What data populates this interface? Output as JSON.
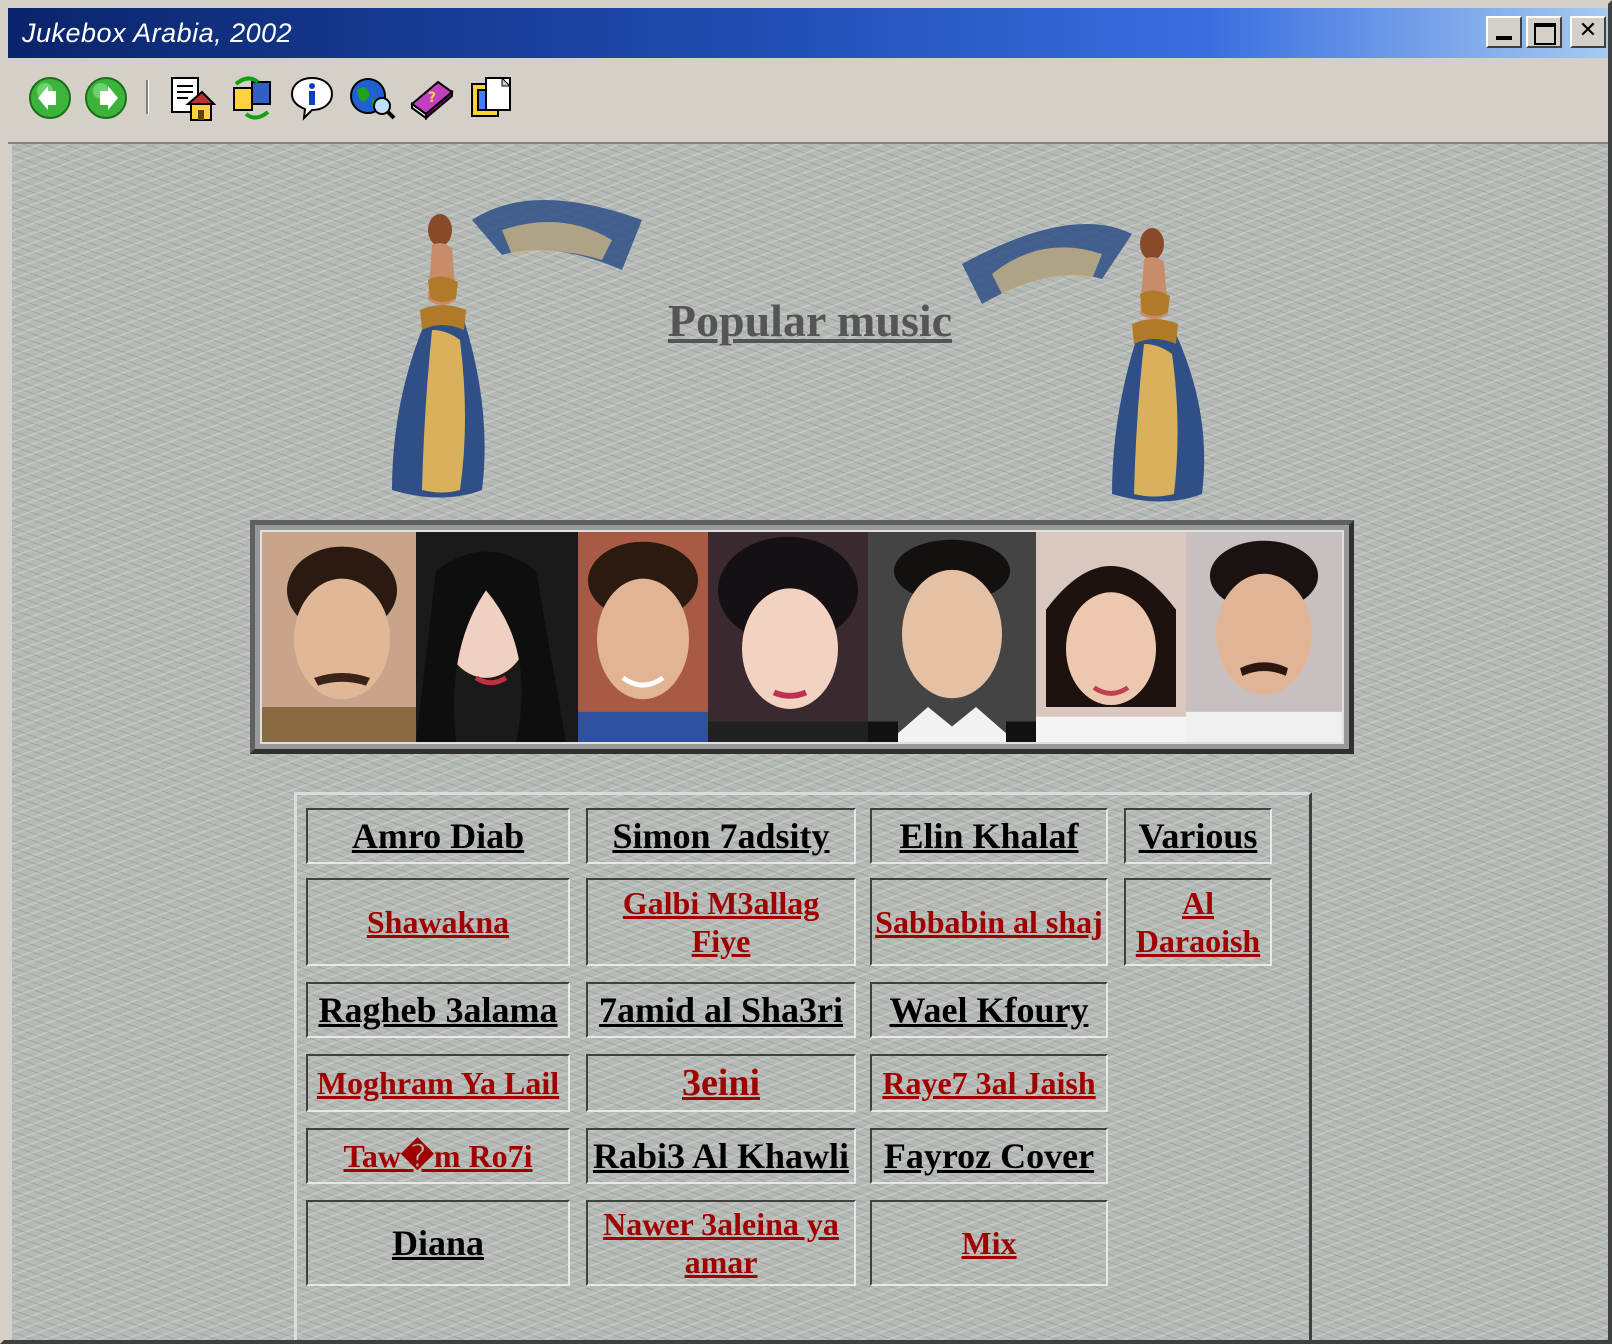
{
  "window": {
    "title": "Jukebox Arabia, 2002",
    "min_glyph": "",
    "max_glyph": "",
    "close_glyph": "✕"
  },
  "toolbar": {
    "icons": [
      "back-arrow-icon",
      "forward-arrow-icon",
      "home-document-icon",
      "refresh-exchange-icon",
      "info-icon",
      "globe-search-icon",
      "help-book-icon",
      "document-frame-icon"
    ]
  },
  "page": {
    "heading": "Popular music"
  },
  "grid": {
    "r1": [
      "Amro Diab",
      "Simon 7adsity",
      "Elin Khalaf",
      "Various"
    ],
    "r2": [
      "Shawakna",
      "Galbi M3allag Fiye",
      "Sabbabin al shaj",
      "Al Daraoish"
    ],
    "r3": [
      "Ragheb 3alama",
      "7amid al Sha3ri",
      "Wael Kfoury"
    ],
    "r4": [
      "Moghram Ya Lail",
      "3eini",
      "Raye7 3al Jaish"
    ],
    "r5": [
      "Taw�m Ro7i",
      "Rabi3 Al Khawli",
      "Fayroz Cover"
    ],
    "r6": [
      "Diana",
      "Nawer 3aleina ya amar",
      "Mix"
    ]
  },
  "colors": {
    "titlebar_start": "#0a246a",
    "titlebar_end": "#a6caf0",
    "artist_text": "#000000",
    "song_link": "#a00000",
    "heading_text": "#555555"
  }
}
